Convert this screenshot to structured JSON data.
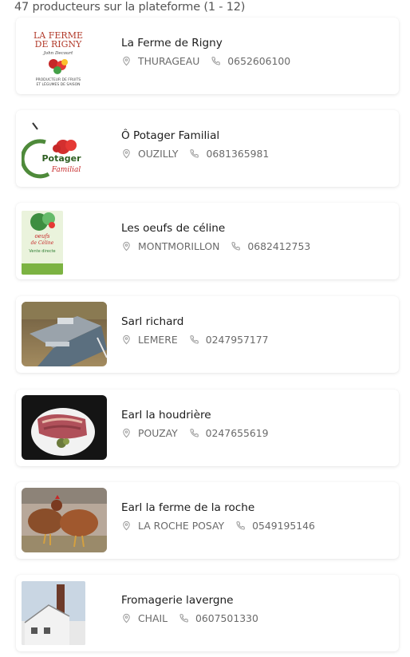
{
  "header": {
    "count_text": "47 producteurs sur la plateforme (1 - 12)"
  },
  "producers": [
    {
      "name": "La Ferme de Rigny",
      "town": "THURAGEAU",
      "phone": "0652606100",
      "logo": {
        "line1": "LA FERME",
        "line2": "DE RIGNY",
        "line3": "John Decourt",
        "line4": "PRODUCTEUR DE FRUITS",
        "line5": "ET LÉGUMES DE SAISON"
      }
    },
    {
      "name": "Ô Potager Familial",
      "town": "OUZILLY",
      "phone": "0681365981",
      "logo": {
        "line1": "Potager",
        "line2": "Familial"
      }
    },
    {
      "name": "Les oeufs de céline",
      "town": "MONTMORILLON",
      "phone": "0682412753",
      "logo": {
        "line1": "oeufs",
        "line2": "de Céline",
        "line3": "Vente directe"
      }
    },
    {
      "name": "Sarl richard",
      "town": "LEMERE",
      "phone": "0247957177"
    },
    {
      "name": "Earl la houdrière",
      "town": "POUZAY",
      "phone": "0247655619"
    },
    {
      "name": "Earl la ferme de la roche",
      "town": "LA ROCHE POSAY",
      "phone": "0549195146"
    },
    {
      "name": "Fromagerie lavergne",
      "town": "CHAIL",
      "phone": "0607501330"
    }
  ],
  "icons": {
    "location": "map-pin-icon",
    "phone": "phone-icon"
  },
  "colors": {
    "text_muted": "#6a6a6a",
    "green": "#5a9a3a",
    "red": "#c0392b"
  }
}
